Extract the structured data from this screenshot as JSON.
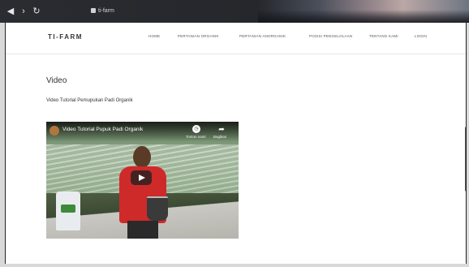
{
  "browser": {
    "back_glyph": "◀",
    "forward_glyph": "›",
    "reload_glyph": "↻",
    "address_text": "ti-farm",
    "chrome_tab_text": ""
  },
  "site": {
    "logo": "TI-FARM",
    "menu": [
      "HOME",
      "PERTANIAN ORGANIK",
      "PERTANIAN ANORGANIK",
      "POSISI PENGELOLAAN",
      "TENTANG KAMI",
      "LOGIN"
    ]
  },
  "content": {
    "heading": "Video",
    "video_title": "Video Tutorial Pemupukan Padi Organik",
    "player": {
      "overlay_title": "Video Tutorial Pupuk Padi Organik",
      "watch_later_label": "Tonton nanti",
      "share_label": "Bagikan",
      "clock_icon_glyph": "◷",
      "share_icon_glyph": "➦"
    }
  },
  "colors": {
    "accent_red": "#cf2a2a",
    "page_bg": "#ffffff",
    "frame": "#d9d9d9"
  }
}
